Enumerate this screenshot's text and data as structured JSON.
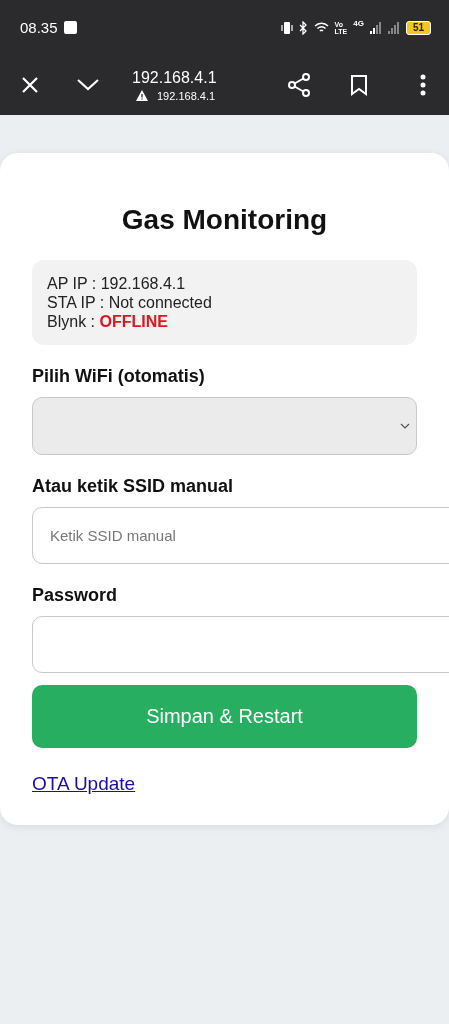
{
  "status_bar": {
    "time": "08.35",
    "network_labels": [
      "Vo",
      "LTE",
      "4G"
    ],
    "battery": "51"
  },
  "browser_toolbar": {
    "title": "192.168.4.1",
    "url": "192.168.4.1"
  },
  "page": {
    "title": "Gas Monitoring",
    "info": [
      "AP IP : 192.168.4.1",
      "STA IP : Not connected",
      "Blynk : **OFFLINE**"
    ],
    "fields": [
      {
        "kind": "select",
        "label": "Pilih WiFi (otomatis)"
      },
      {
        "kind": "text",
        "label": "Atau ketik SSID manual",
        "placeholder": "Ketik SSID manual"
      },
      {
        "kind": "password",
        "label": "Password"
      }
    ],
    "submit": "Simpan & Restart",
    "link": "OTA Update"
  }
}
